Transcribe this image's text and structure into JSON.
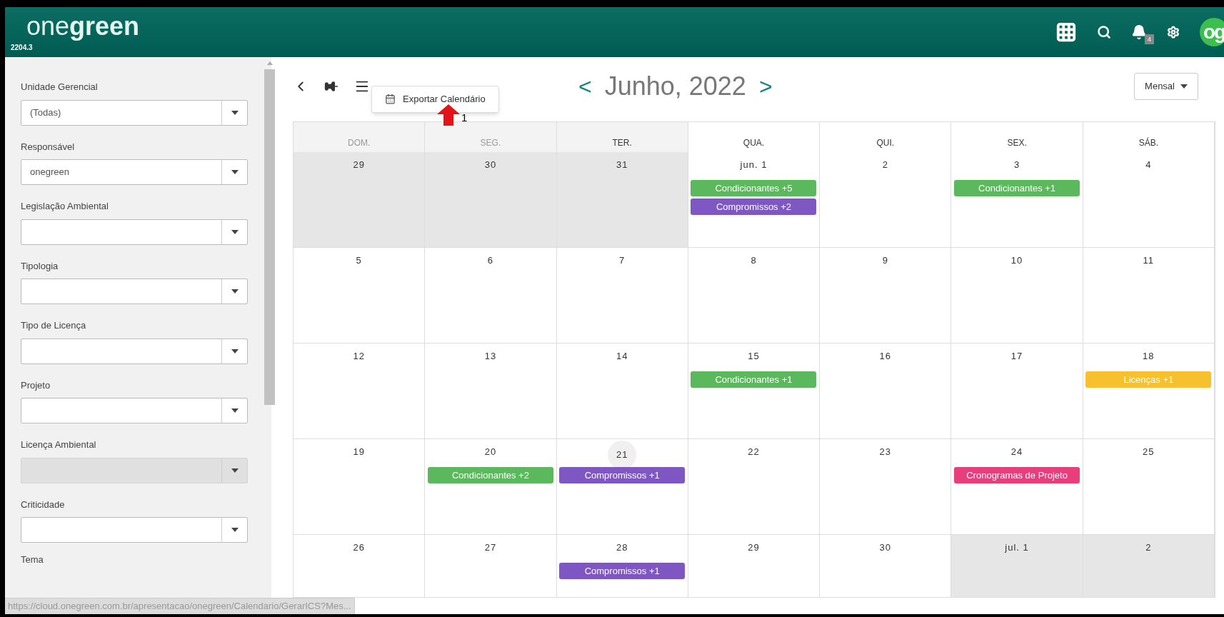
{
  "header": {
    "logo_light": "one",
    "logo_bold": "green",
    "version": "2204.3",
    "notification_count": "4",
    "avatar": "og"
  },
  "sidebar": {
    "filters": [
      {
        "label": "Unidade Gerencial",
        "value": "(Todas)",
        "disabled": false
      },
      {
        "label": "Responsável",
        "value": "onegreen",
        "disabled": false
      },
      {
        "label": "Legislação Ambiental",
        "disabled": false
      },
      {
        "label": "Tipologia",
        "disabled": false
      },
      {
        "label": "Tipo de Licença",
        "disabled": false
      },
      {
        "label": "Projeto",
        "disabled": false
      },
      {
        "label": "Licença Ambiental",
        "disabled": true
      },
      {
        "label": "Criticidade",
        "disabled": false
      }
    ],
    "last_label": "Tema"
  },
  "calendar": {
    "prev": "<",
    "title": "Junho, 2022",
    "next": ">",
    "view": "Mensal",
    "menu": {
      "items": [
        "Exportar Calendário"
      ]
    },
    "annotation": "1",
    "weekdays": [
      "DOM.",
      "SEG.",
      "TER.",
      "QUA.",
      "QUI.",
      "SEX.",
      "SÁB."
    ],
    "weeks": [
      [
        {
          "day": "29",
          "outside": true,
          "today": false
        },
        {
          "day": "30",
          "outside": true,
          "today": false
        },
        {
          "day": "31",
          "outside": true,
          "today": false
        },
        {
          "day": "jun. 1",
          "outside": false,
          "today": false,
          "events": [
            {
              "label": "Condicionantes +5",
              "color": "#5cb85c"
            },
            {
              "label": "Compromissos +2",
              "color": "#7e57c2"
            }
          ]
        },
        {
          "day": "2",
          "outside": false,
          "today": false
        },
        {
          "day": "3",
          "outside": false,
          "today": false,
          "events": [
            {
              "label": "Condicionantes +1",
              "color": "#5cb85c"
            }
          ]
        },
        {
          "day": "4",
          "outside": false,
          "today": false
        }
      ],
      [
        {
          "day": "5",
          "outside": false,
          "today": false
        },
        {
          "day": "6",
          "outside": false,
          "today": false
        },
        {
          "day": "7",
          "outside": false,
          "today": false
        },
        {
          "day": "8",
          "outside": false,
          "today": false
        },
        {
          "day": "9",
          "outside": false,
          "today": false
        },
        {
          "day": "10",
          "outside": false,
          "today": false
        },
        {
          "day": "11",
          "outside": false,
          "today": false
        }
      ],
      [
        {
          "day": "12",
          "outside": false,
          "today": false
        },
        {
          "day": "13",
          "outside": false,
          "today": false
        },
        {
          "day": "14",
          "outside": false,
          "today": false
        },
        {
          "day": "15",
          "outside": false,
          "today": false,
          "events": [
            {
              "label": "Condicionantes +1",
              "color": "#5cb85c"
            }
          ]
        },
        {
          "day": "16",
          "outside": false,
          "today": false
        },
        {
          "day": "17",
          "outside": false,
          "today": false
        },
        {
          "day": "18",
          "outside": false,
          "today": false,
          "events": [
            {
              "label": "Licenças +1",
              "color": "#f6c02e"
            }
          ]
        }
      ],
      [
        {
          "day": "19",
          "outside": false,
          "today": false
        },
        {
          "day": "20",
          "outside": false,
          "today": false,
          "events": [
            {
              "label": "Condicionantes +2",
              "color": "#5cb85c"
            }
          ]
        },
        {
          "day": "21",
          "outside": false,
          "today": true,
          "events": [
            {
              "label": "Compromissos +1",
              "color": "#7e57c2"
            }
          ]
        },
        {
          "day": "22",
          "outside": false,
          "today": false
        },
        {
          "day": "23",
          "outside": false,
          "today": false
        },
        {
          "day": "24",
          "outside": false,
          "today": false,
          "events": [
            {
              "label": "Cronogramas de Projeto",
              "color": "#e83e7c"
            }
          ]
        },
        {
          "day": "25",
          "outside": false,
          "today": false
        }
      ],
      [
        {
          "day": "26",
          "outside": false,
          "today": false
        },
        {
          "day": "27",
          "outside": false,
          "today": false
        },
        {
          "day": "28",
          "outside": false,
          "today": false,
          "events": [
            {
              "label": "Compromissos +1",
              "color": "#7e57c2"
            }
          ]
        },
        {
          "day": "29",
          "outside": false,
          "today": false
        },
        {
          "day": "30",
          "outside": false,
          "today": false
        },
        {
          "day": "jul. 1",
          "outside": true,
          "today": false
        },
        {
          "day": "2",
          "outside": true,
          "today": false
        }
      ]
    ]
  },
  "status_bar": {
    "url": "https://cloud.onegreen.com.br/apresentacao/onegreen/Calendario/GerarICS?Mes..."
  }
}
